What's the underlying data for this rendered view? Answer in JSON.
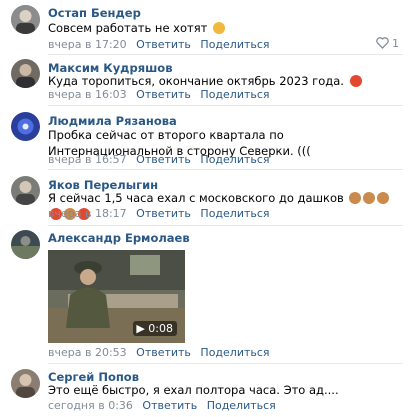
{
  "actions": {
    "reply": "Ответить",
    "share": "Поделиться"
  },
  "comments": [
    {
      "author": "Остап Бендер",
      "text": "Совсем работать не хотят",
      "time": "вчера в 17:20",
      "likes": "1",
      "emoji": "grimace-emoji"
    },
    {
      "author": "Максим Кудряшов",
      "text": "Куда торопиться, окончание октябрь 2023 года.",
      "time": "вчера в 16:03",
      "emoji": "angry-emoji"
    },
    {
      "author": "Людмила Рязанова",
      "text": "Пробка сейчас от второго квартала по Интернациональной в сторону Северки. (((",
      "time": "вчера в 16:57"
    },
    {
      "author": "Яков Перелыгин",
      "text": "Я сейчас 1,5 часа ехал с московского до дашков",
      "time": "вчера в 18:17",
      "emoji": "see-no-evil-monkey-and-angry-emoji-row"
    },
    {
      "author": "Александр Ермолаев",
      "time": "вчера в 20:53",
      "video": {
        "duration": "0:08"
      }
    },
    {
      "author": "Сергей Попов",
      "text": "Это ещё быстро, я ехал полтора часа. Это ад....",
      "time": "сегодня в 0:36"
    }
  ],
  "colors": {
    "link": "#2a5885",
    "meta": "#818c99",
    "angry": "#e2482f",
    "monkey": "#c98a4b"
  }
}
